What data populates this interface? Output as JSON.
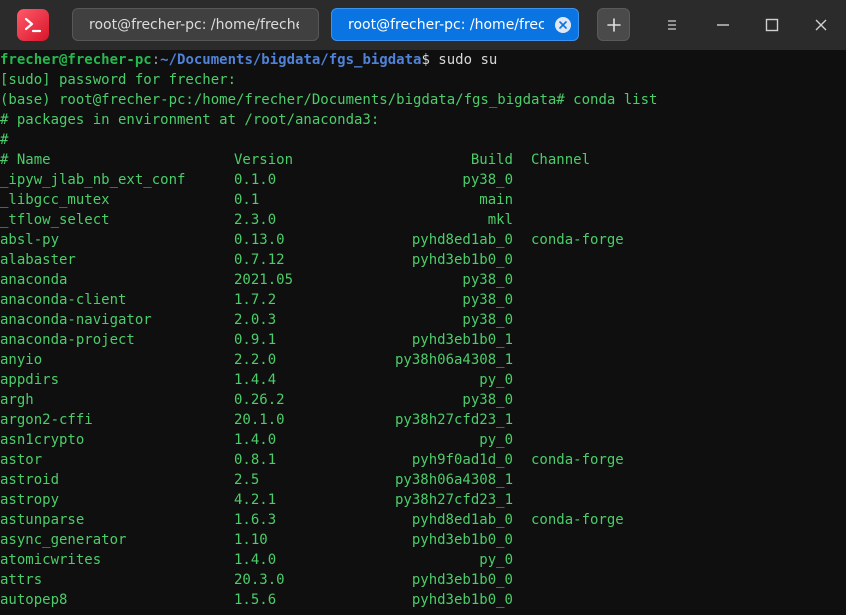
{
  "tabs": [
    {
      "label": "root@frecher-pc: /home/frecher/Documents/bigdata/fgs_bigdata",
      "active": false
    },
    {
      "label": "root@frecher-pc: /home/frecher/Documents/bigdata/fgs_bigdata",
      "active": true
    }
  ],
  "colors": {
    "titlebar": "#2b2b2b",
    "active_tab": "#0a74e3",
    "terminal_bg": "#0f0f0f",
    "text": "#4ccc6a",
    "user": "#26b94f",
    "path": "#4f82d8"
  },
  "icons": {
    "app": "terminal-app-icon",
    "new_tab": "plus-icon",
    "menu": "hamburger-menu-icon",
    "minimize": "minimize-icon",
    "maximize": "maximize-icon",
    "close": "close-icon"
  },
  "terminal": {
    "prompt_user": "frecher@frecher-pc",
    "prompt_sep": ":",
    "prompt_path": "~/Documents/bigdata/fgs_bigdata",
    "prompt_cmd": "$ sudo su",
    "sudo_line": "[sudo] password for frecher:",
    "root_line": "(base) root@frecher-pc:/home/frecher/Documents/bigdata/fgs_bigdata# conda list",
    "env_line": "# packages in environment at /root/anaconda3:",
    "hash_line": "#",
    "headers": {
      "name": "# Name",
      "version": "Version",
      "build": "Build",
      "channel": "Channel"
    },
    "packages": [
      {
        "name": "_ipyw_jlab_nb_ext_conf",
        "version": "0.1.0",
        "build": "py38_0",
        "channel": ""
      },
      {
        "name": "_libgcc_mutex",
        "version": "0.1",
        "build": "main",
        "channel": ""
      },
      {
        "name": "_tflow_select",
        "version": "2.3.0",
        "build": "mkl",
        "channel": ""
      },
      {
        "name": "absl-py",
        "version": "0.13.0",
        "build": "pyhd8ed1ab_0",
        "channel": "conda-forge"
      },
      {
        "name": "alabaster",
        "version": "0.7.12",
        "build": "pyhd3eb1b0_0",
        "channel": ""
      },
      {
        "name": "anaconda",
        "version": "2021.05",
        "build": "py38_0",
        "channel": ""
      },
      {
        "name": "anaconda-client",
        "version": "1.7.2",
        "build": "py38_0",
        "channel": ""
      },
      {
        "name": "anaconda-navigator",
        "version": "2.0.3",
        "build": "py38_0",
        "channel": ""
      },
      {
        "name": "anaconda-project",
        "version": "0.9.1",
        "build": "pyhd3eb1b0_1",
        "channel": ""
      },
      {
        "name": "anyio",
        "version": "2.2.0",
        "build": "py38h06a4308_1",
        "channel": ""
      },
      {
        "name": "appdirs",
        "version": "1.4.4",
        "build": "py_0",
        "channel": ""
      },
      {
        "name": "argh",
        "version": "0.26.2",
        "build": "py38_0",
        "channel": ""
      },
      {
        "name": "argon2-cffi",
        "version": "20.1.0",
        "build": "py38h27cfd23_1",
        "channel": ""
      },
      {
        "name": "asn1crypto",
        "version": "1.4.0",
        "build": "py_0",
        "channel": ""
      },
      {
        "name": "astor",
        "version": "0.8.1",
        "build": "pyh9f0ad1d_0",
        "channel": "conda-forge"
      },
      {
        "name": "astroid",
        "version": "2.5",
        "build": "py38h06a4308_1",
        "channel": ""
      },
      {
        "name": "astropy",
        "version": "4.2.1",
        "build": "py38h27cfd23_1",
        "channel": ""
      },
      {
        "name": "astunparse",
        "version": "1.6.3",
        "build": "pyhd8ed1ab_0",
        "channel": "conda-forge"
      },
      {
        "name": "async_generator",
        "version": "1.10",
        "build": "pyhd3eb1b0_0",
        "channel": ""
      },
      {
        "name": "atomicwrites",
        "version": "1.4.0",
        "build": "py_0",
        "channel": ""
      },
      {
        "name": "attrs",
        "version": "20.3.0",
        "build": "pyhd3eb1b0_0",
        "channel": ""
      },
      {
        "name": "autopep8",
        "version": "1.5.6",
        "build": "pyhd3eb1b0_0",
        "channel": ""
      }
    ]
  }
}
